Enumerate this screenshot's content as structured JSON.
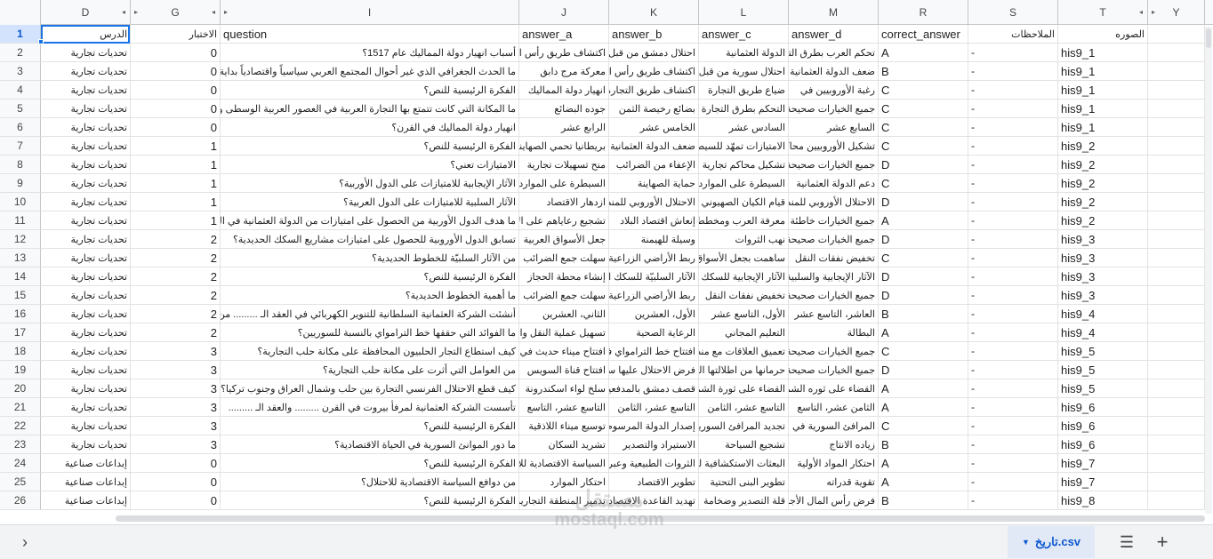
{
  "columns": [
    "D",
    "G",
    "I",
    "J",
    "K",
    "L",
    "M",
    "R",
    "S",
    "T",
    "Y"
  ],
  "header_row": {
    "row_number": "1",
    "cells": [
      "الدرس",
      "الاختبار",
      "question",
      "answer_a",
      "answer_b",
      "answer_c",
      "answer_d",
      "correct_answer",
      "الملاحظات",
      "الصوره",
      ""
    ]
  },
  "rows": [
    {
      "n": "2",
      "c": [
        "تحديات تجارية",
        "0",
        "أسباب انهيار دولة المماليك عام 1517؟",
        "اكتشاف طريق رأس الرجاء الصالح",
        "احتلال دمشق من قبل العثمانيين",
        "الدولة العثمانية",
        "تحكم العرب بطرق التجارة",
        "A",
        "-",
        "his9_1",
        ""
      ]
    },
    {
      "n": "3",
      "c": [
        "تحديات تجارية",
        "0",
        "ما الحدث الجغرافي الذي غير أحوال المجتمع العربي سياسياً واقتصادياً بداية العصر الحديث؟",
        "معركة مرج دابق",
        "اكتشاف طريق رأس الرجاء",
        "احتلال سورية من قبل",
        "ضعف الدولة العثمانية",
        "B",
        "-",
        "his9_1",
        ""
      ]
    },
    {
      "n": "4",
      "c": [
        "تحديات تجارية",
        "0",
        "الفكرة الرئيسية للنص؟",
        "انهيار دولة المماليك",
        "اكتشاف طريق التجارة",
        "ضياع طريق التجارة",
        "رغبة الأوروبيين في",
        "C",
        "-",
        "his9_1",
        ""
      ]
    },
    {
      "n": "5",
      "c": [
        "تحديات تجارية",
        "0",
        "ما المكانة التي كانت تتمتع بها التجارة العربية في العصور العربية الوسطى والقديمة؟",
        "جوده البضائع",
        "بضائع رخيصة الثمن",
        "التحكم بطرق التجارة",
        "جميع الخيارات صحيحة",
        "C",
        "-",
        "his9_1",
        ""
      ]
    },
    {
      "n": "6",
      "c": [
        "تحديات تجارية",
        "0",
        "انهيار دولة المماليك في القرن؟",
        "الرابع عشر",
        "الخامس عشر",
        "السادس عشر",
        "السابع عشر",
        "C",
        "-",
        "his9_1",
        ""
      ]
    },
    {
      "n": "7",
      "c": [
        "تحديات تجارية",
        "1",
        "الفكرة الرئيسية للنص؟",
        "بريطانيا تحمي الصهاينة",
        "ضعف الدولة العثمانية",
        "الامتيازات تمهّد للسيطرة",
        "تشكيل الأوروبيين محاكم",
        "C",
        "-",
        "his9_2",
        ""
      ]
    },
    {
      "n": "8",
      "c": [
        "تحديات تجارية",
        "1",
        "الامتيازات تعني؟",
        "منح تسهيلات تجارية",
        "الإعفاء من الضرائب",
        "تشكيل محاكم تجارية خاصة",
        "جميع الخيارات صحيحة",
        "D",
        "-",
        "his9_2",
        ""
      ]
    },
    {
      "n": "9",
      "c": [
        "تحديات تجارية",
        "1",
        "الآثار الإيجابية للامتيازات على الدول الأوربية؟",
        "السيطرة على الموارد",
        "حماية الصهاينة",
        "السيطرة على الموارد",
        "دعم الدولة العثمانية",
        "C",
        "-",
        "his9_2",
        ""
      ]
    },
    {
      "n": "10",
      "c": [
        "تحديات تجارية",
        "1",
        "الآثار السلبية للامتيازات على الدول العربية؟",
        "ازدهار الاقتصاد",
        "الاحتلال الأوروبي للمنطقة",
        "قيام الكيان الصهيوني",
        "الاحتلال الأوروبي للمنطقة",
        "D",
        "-",
        "his9_2",
        ""
      ]
    },
    {
      "n": "11",
      "c": [
        "تحديات تجارية",
        "1",
        "ما هدف الدول الأوربية من الحصول على امتيازات من الدولة العثمانية في المنطقة؟",
        "تشجيع رعاياهم على الاستثمار",
        "إنعاش اقتصاد البلاد",
        "معرفة العرب ومخططاتهم",
        "جميع الخيارات خاطئة",
        "A",
        "-",
        "his9_2",
        ""
      ]
    },
    {
      "n": "12",
      "c": [
        "تحديات تجارية",
        "2",
        "تسابق الدول الأوروبية للحصول على امتيازات مشاريع السكك الحديدية؟",
        "جعل الأسواق العربية",
        "وسيلة للهيمنة",
        "نهب الثروات",
        "جميع الخيارات صحيحة",
        "D",
        "-",
        "his9_3",
        ""
      ]
    },
    {
      "n": "13",
      "c": [
        "تحديات تجارية",
        "2",
        "من الآثار السلبيّة للخطوط الحديدية؟",
        "سهلت جمع الضرائب",
        "ربط الأراضي الزراعية",
        "ساهمت بجعل الأسواق",
        "تخفيض نفقات النقل",
        "C",
        "-",
        "his9_3",
        ""
      ]
    },
    {
      "n": "14",
      "c": [
        "تحديات تجارية",
        "2",
        "الفكرة الرئيسية للنص؟",
        "إنشاء محطة الحجاز",
        "الآثار السلبيّة للسكك الحديدية",
        "الآثار الإيجابية للسكك",
        "الآثار الإيجابية والسلبية",
        "D",
        "-",
        "his9_3",
        ""
      ]
    },
    {
      "n": "15",
      "c": [
        "تحديات تجارية",
        "2",
        "ما أهمية الخطوط الحديدية؟",
        "سهلت جمع الضرائب",
        "ربط الأراضي الزراعية",
        "تخفيض نفقات النقل",
        "جميع الخيارات صحيحة",
        "D",
        "-",
        "his9_3",
        ""
      ]
    },
    {
      "n": "16",
      "c": [
        "تحديات تجارية",
        "2",
        "أنشئت الشركة العثمانية السلطانية للتنوير الكهربائي في العقد الـ ......... من القرن ......",
        "الثاني، العشرين",
        "الأول، العشرين",
        "الأول، التاسع عشر",
        "العاشر، التاسع عشر",
        "B",
        "-",
        "his9_4",
        ""
      ]
    },
    {
      "n": "17",
      "c": [
        "تحديات تجارية",
        "2",
        "ما الفوائد التي حققها خط الترامواي بالنسبة للسوريين؟",
        "تسهيل عملية النقل والتنقل",
        "الرعاية الصحية",
        "التعليم المجاني",
        "البطالة",
        "A",
        "-",
        "his9_4",
        ""
      ]
    },
    {
      "n": "18",
      "c": [
        "تحديات تجارية",
        "3",
        "كيف استطاع التجار الحلبيون المحافظة على مكانة حلب التجارية؟",
        "افتتاح ميناء حديث في",
        "افتتاح خط الترامواي في حلب",
        "تعميق العلاقات مع منطقة",
        "جميع الخيارات صحيحة",
        "C",
        "-",
        "his9_5",
        ""
      ]
    },
    {
      "n": "19",
      "c": [
        "تحديات تجارية",
        "3",
        "من العوامل التي أثرت على مكانة حلب التجارية؟",
        "افتتاح قناة السويس",
        "فرض الاحتلال عليها سياسة",
        "حرمانها من اطلالتها البحرية",
        "جميع الخيارات صحيحة",
        "D",
        "-",
        "his9_5",
        ""
      ]
    },
    {
      "n": "20",
      "c": [
        "تحديات تجارية",
        "3",
        "كيف قطع الاحتلال الفرنسي التجارة بين حلب وشمال العراق وجنوب تركيا؟",
        "سلخ لواء اسكندرونة",
        "قصف دمشق بالمدفعية",
        "القضاء على ثورة الشمال",
        "القضاء على ثوره الشمال",
        "A",
        "-",
        "his9_5",
        ""
      ]
    },
    {
      "n": "21",
      "c": [
        "تحديات تجارية",
        "3",
        "تأسست الشركة العثمانية لمرفأ بيروت في القرن ......... والعقد الـ .........",
        "التاسع عشر، التاسع",
        "التاسع عشر، الثامن",
        "التاسع عشر، الثامن",
        "الثامن عشر، التاسع",
        "A",
        "-",
        "his9_6",
        ""
      ]
    },
    {
      "n": "22",
      "c": [
        "تحديات تجارية",
        "3",
        "الفكرة الرئيسية للنص؟",
        "توسيع ميناء اللاذقية",
        "إصدار الدولة المرسوم",
        "تجديد المرافئ السورية",
        "المرافئ السورية في الماضي",
        "C",
        "-",
        "his9_6",
        ""
      ]
    },
    {
      "n": "23",
      "c": [
        "تحديات تجارية",
        "3",
        "ما دور الموانئ السورية في الحياة الاقتصادية؟",
        "تشريد السكان",
        "الاستيراد والتصدير",
        "تشجيع السياحة",
        "زياده الانتاج",
        "B",
        "-",
        "his9_6",
        ""
      ]
    },
    {
      "n": "24",
      "c": [
        "إبداعات صناعية",
        "0",
        "الفكرة الرئيسية للنص؟",
        "السياسة الاقتصادية للاحتلال",
        "الثروات الطبيعية وعبر",
        "البعثات الاستكشافية للاحتلال",
        "احتكار المواد الأولية",
        "A",
        "-",
        "his9_7",
        ""
      ]
    },
    {
      "n": "25",
      "c": [
        "إبداعات صناعية",
        "0",
        "من دوافع السياسة الاقتصادية للاحتلال؟",
        "احتكار الموارد",
        "تطوير الاقتصاد",
        "تطوير البنى التحتية",
        "تقوية قدراته",
        "A",
        "-",
        "his9_7",
        ""
      ]
    },
    {
      "n": "26",
      "c": [
        "إبداعات صناعية",
        "0",
        "الفكرة الرئيسية للنص؟",
        "تدمير المنطقة التجارية",
        "تهديد القاعدة الاقتصادية",
        "قلة التصدير وضخامة",
        "فرض رأس المال الأجنبي",
        "B",
        "-",
        "his9_8",
        ""
      ]
    }
  ],
  "footer": {
    "sheet_tab": "تاريخ.csv",
    "watermark_ar": "مستقل",
    "watermark_en": "mostaql.com"
  }
}
